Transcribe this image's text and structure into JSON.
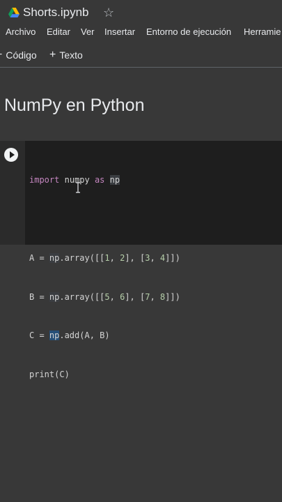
{
  "header": {
    "doc_title": "Shorts.ipynb",
    "star_icon": "star-icon",
    "logo_icon": "google-drive-icon"
  },
  "menu": {
    "items": [
      {
        "label": "Archivo"
      },
      {
        "label": "Editar"
      },
      {
        "label": "Ver"
      },
      {
        "label": "Insertar"
      },
      {
        "label": "Entorno de ejecución"
      },
      {
        "label": "Herramie"
      }
    ]
  },
  "toolbar": {
    "code_label": "Código",
    "text_label": "Texto",
    "plus_icon": "plus-icon"
  },
  "notebook": {
    "heading": "NumPy en Python",
    "cell": {
      "run_icon": "play-icon",
      "lines": [
        "import numpy as np",
        "",
        "A = np.array([[1, 2], [3, 4]])",
        "B = np.array([[5, 6], [7, 8]])",
        "C = np.add(A, B)",
        "print(C)"
      ],
      "tokens": {
        "import": "import",
        "numpy": "numpy",
        "as": "as",
        "np": "np",
        "a_assign": "A = ",
        "b_assign": "B = ",
        "c_assign": "C = ",
        "array_call": ".array(",
        "a_lit_open": "[[",
        "n1": "1",
        "n2": "2",
        "n3": "3",
        "n4": "4",
        "n5": "5",
        "n6": "6",
        "n7": "7",
        "n8": "8",
        "add_call": ".add(A, B)",
        "print_line": "print(C)"
      }
    }
  },
  "colors": {
    "background": "#383838",
    "cell_background": "#1e1e1e",
    "keyword": "#c586c0",
    "number": "#b5cea8",
    "text": "#e8eaed"
  }
}
